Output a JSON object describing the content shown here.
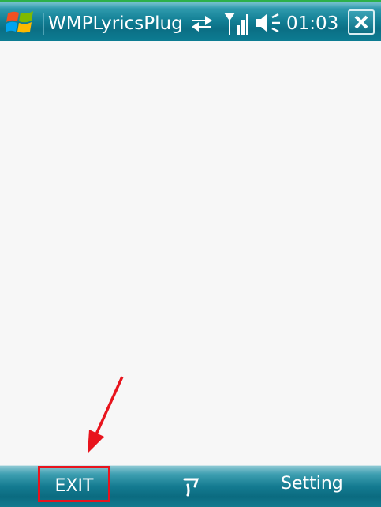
{
  "titlebar": {
    "start_icon": "windows-flag-icon",
    "app_title": "WMPLyricsPlugi",
    "status_icons": [
      "data-connection-icon",
      "signal-strength-icon",
      "volume-icon"
    ],
    "clock": "01:03",
    "close_icon": "close-x-icon"
  },
  "softbar": {
    "left_label": "EXIT",
    "center_icon": "input-panel-icon",
    "right_label": "Setting"
  },
  "colors": {
    "bar_teal": "#127f95",
    "highlight_red": "#e8141d",
    "content_bg": "#f7f7f7"
  }
}
